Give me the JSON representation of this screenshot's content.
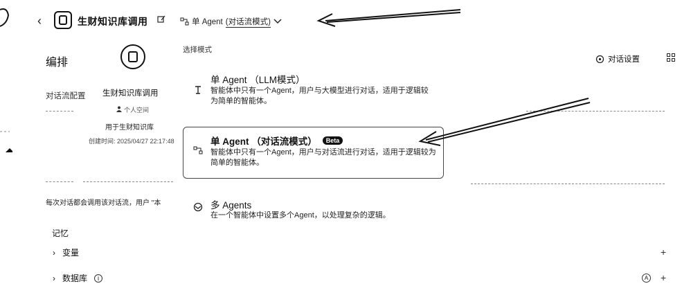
{
  "header": {
    "back_icon": "chevron-left-icon",
    "app_title": "生财知识库调用",
    "mode_main": "单 Agent",
    "mode_sub": "(对话流模式)"
  },
  "left": {
    "section_title": "编排",
    "flow_label": "对话流配置",
    "bot_name": "生财知识库调用",
    "owner": "个人空间",
    "description": "用于生财知识库",
    "created": "创建时间: 2025/04/27 22:17:48",
    "flow_note": "每次对话都会调用该对话流，用户 \"本",
    "memory_title": "记忆",
    "var_label": "变量",
    "db_label": "数据库"
  },
  "dropdown": {
    "label": "选择模式",
    "options": [
      {
        "title": "单 Agent （LLM模式）",
        "desc": "智能体中只有一个Agent，用户与大模型进行对话，适用于逻辑较为简单的智能体。"
      },
      {
        "title": "单 Agent （对话流模式）",
        "badge": "Beta",
        "desc": "智能体中只有一个Agent，用户与对话流进行对话，适用于逻辑较为简单的智能体。"
      },
      {
        "title": "多 Agents",
        "desc": "在一个智能体中设置多个Agent，以处理复杂的逻辑。"
      }
    ]
  },
  "right": {
    "settings_label": "对话设置",
    "plus": "+",
    "a_glyph": "A",
    "info_glyph": "i"
  },
  "colors": {
    "text": "#111111",
    "border": "#444444",
    "badge_bg": "#111111"
  }
}
